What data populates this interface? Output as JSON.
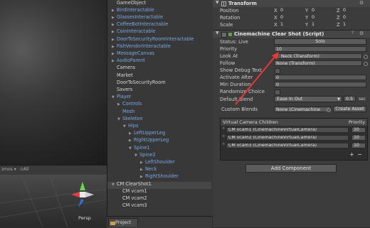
{
  "hierarchy": {
    "items": [
      {
        "label": "GameObject",
        "indent": 0,
        "color": "white",
        "expand": ""
      },
      {
        "label": "BirdInteractable",
        "indent": 0,
        "color": "blue",
        "expand": "▶"
      },
      {
        "label": "GlassesInteractable",
        "indent": 0,
        "color": "blue",
        "expand": "▶"
      },
      {
        "label": "CoffeeBotInteractable",
        "indent": 0,
        "color": "blue",
        "expand": "▶"
      },
      {
        "label": "CoinInteractable",
        "indent": 0,
        "color": "blue",
        "expand": "▶"
      },
      {
        "label": "DoorToSecurityRoomInteractable",
        "indent": 0,
        "color": "blue",
        "expand": "▶"
      },
      {
        "label": "FishVendorInteractable",
        "indent": 0,
        "color": "blue",
        "expand": "▶"
      },
      {
        "label": "MessageCanvas",
        "indent": 0,
        "color": "blue",
        "expand": "▶"
      },
      {
        "label": "AudioParent",
        "indent": 0,
        "color": "blue",
        "expand": "▶"
      },
      {
        "label": "Camera",
        "indent": 0,
        "color": "white",
        "expand": ""
      },
      {
        "label": "Market",
        "indent": 0,
        "color": "white",
        "expand": ""
      },
      {
        "label": "DoorToSecurityRoom",
        "indent": 0,
        "color": "white",
        "expand": ""
      },
      {
        "label": "Savers",
        "indent": 0,
        "color": "white",
        "expand": ""
      },
      {
        "label": "Player",
        "indent": 0,
        "color": "blue",
        "expand": "▼"
      },
      {
        "label": "Controls",
        "indent": 1,
        "color": "blue",
        "expand": "▶"
      },
      {
        "label": "Mesh",
        "indent": 1,
        "color": "blue",
        "expand": ""
      },
      {
        "label": "Skeleton",
        "indent": 1,
        "color": "blue",
        "expand": "▼"
      },
      {
        "label": "Hips",
        "indent": 2,
        "color": "blue",
        "expand": "▼"
      },
      {
        "label": "LeftUpperLeg",
        "indent": 3,
        "color": "blue",
        "expand": "▶"
      },
      {
        "label": "RightUpperLeg",
        "indent": 3,
        "color": "blue",
        "expand": "▶"
      },
      {
        "label": "Spine1",
        "indent": 3,
        "color": "blue",
        "expand": "▼"
      },
      {
        "label": "Spine2",
        "indent": 4,
        "color": "blue",
        "expand": "▼"
      },
      {
        "label": "LeftShoulder",
        "indent": 5,
        "color": "blue",
        "expand": "▶"
      },
      {
        "label": "Neck",
        "indent": 5,
        "color": "blue",
        "expand": "▶"
      },
      {
        "label": "RightShoulder",
        "indent": 5,
        "color": "blue",
        "expand": "▶"
      },
      {
        "label": "CM ClearShot1",
        "indent": 0,
        "color": "white",
        "expand": "▼",
        "selected": true
      },
      {
        "label": "CM vcam1",
        "indent": 1,
        "color": "white",
        "expand": ""
      },
      {
        "label": "CM vcam2",
        "indent": 1,
        "color": "white",
        "expand": ""
      },
      {
        "label": "CM vcam3",
        "indent": 1,
        "color": "white",
        "expand": ""
      }
    ]
  },
  "scene": {
    "tab_left": "zmos ▾",
    "tab_right": "⊙All",
    "persp_label": "Persp"
  },
  "project": {
    "tab_label": "Project"
  },
  "inspector": {
    "transform": {
      "title": "Transform",
      "position_label": "Position",
      "rotation_label": "Rotation",
      "scale_label": "Scale",
      "position": {
        "x": "0",
        "y": "0",
        "z": "0"
      },
      "rotation": {
        "x": "0",
        "y": "0",
        "z": "0"
      },
      "scale": {
        "x": "1",
        "y": "1",
        "z": "1"
      },
      "x_label": "X",
      "y_label": "Y",
      "z_label": "Z"
    },
    "clearshot": {
      "title": "Cinemachine Clear Shot (Script)",
      "status_label": "Status: Live",
      "solo_button": "Solo",
      "priority_label": "Priority",
      "priority_value": "10",
      "lookat_label": "Look At",
      "lookat_value": "Neck (Transform)",
      "follow_label": "Follow",
      "follow_value": "None (Transform)",
      "show_debug_label": "Show Debug Text",
      "activate_after_label": "Activate After",
      "activate_after_value": "0",
      "min_duration_label": "Min Duration",
      "min_duration_value": "0",
      "randomize_label": "Randomize Choice",
      "default_blend_label": "Default Blend",
      "default_blend_value": "Ease In Out",
      "default_blend_time": "0.5",
      "default_blend_unit": "sec",
      "custom_blends_label": "Custom Blends",
      "custom_blends_value": "None (Cinemachine",
      "create_asset_button": "Create Asset"
    },
    "children": {
      "header": "Virtual Camera Children",
      "priority_header": "Priority",
      "rows": [
        {
          "name": "CM vcam1 (CinemachineVirtualCamera)",
          "priority": "10"
        },
        {
          "name": "CM vcam2 (CinemachineVirtualCamera)",
          "priority": "10"
        },
        {
          "name": "CM vcam3 (CinemachineVirtualCamera)",
          "priority": "10"
        }
      ],
      "add_symbol": "+",
      "remove_symbol": "−"
    },
    "add_component_button": "Add Component"
  },
  "colors": {
    "annotation_arrow": "#e8363a",
    "hierarchy_blue": "#7aa7e6"
  }
}
